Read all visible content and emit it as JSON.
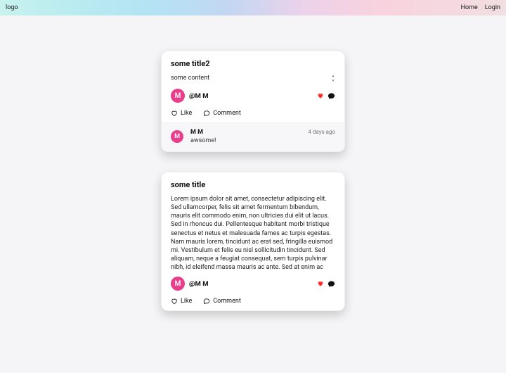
{
  "header": {
    "logo": "logo",
    "nav": {
      "home": "Home",
      "login": "Login"
    }
  },
  "avatar_letter": "M",
  "posts": [
    {
      "title": "some title2",
      "content": "some content",
      "content_short": true,
      "author_handle": "@M M",
      "like_label": "Like",
      "comment_label": "Comment",
      "comment": {
        "name": "M M",
        "body": "awsome!",
        "time": "4 days ago"
      }
    },
    {
      "title": "some title",
      "content": "Lorem ipsum dolor sit amet, consectetur adipiscing elit. Sed ullamcorper, felis sit amet fermentum bibendum, mauris elit commodo enim, non ultricies dui elit ut lacus. Sed in rhoncus dui. Pellentesque habitant morbi tristique senectus et netus et malesuada fames ac turpis egestas. Nam mauris lorem, tincidunt ac erat sed, fringilla euismod mi. Vestibulum et felis eu nisl sollicitudin tincidunt. Sed aliquam, neque a feugiat consequat, sem turpis pulvinar nibh, id eleifend massa mauris ac ante. Sed at enim ac ante ultrices finibus. In hac habitasse platea dictumst. Sed gravida ex arcu, eget aliquam diam sagittis eget. Aenean auctor, mauris eget tincidunt ultricies, risus sem tincidunt magna, vitae pharetra turpis enim a sapien. Fusce congue ligula in risus egestas, eget euismod nunc cursus. Curabitur auctor, urna nec.",
      "content_short": false,
      "author_handle": "@M M",
      "like_label": "Like",
      "comment_label": "Comment"
    }
  ]
}
